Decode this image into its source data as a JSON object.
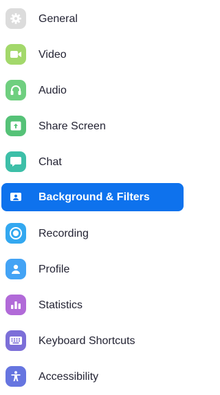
{
  "settings_nav": {
    "selected_index": 5,
    "items": [
      {
        "label": "General",
        "icon": "gear-icon",
        "color": "#dcdcdc"
      },
      {
        "label": "Video",
        "icon": "video-camera-icon",
        "color": "#a3d86b"
      },
      {
        "label": "Audio",
        "icon": "headphones-icon",
        "color": "#6fcf7f"
      },
      {
        "label": "Share Screen",
        "icon": "share-screen-icon",
        "color": "#55c277"
      },
      {
        "label": "Chat",
        "icon": "chat-bubble-icon",
        "color": "#3dbfa8"
      },
      {
        "label": "Background & Filters",
        "icon": "background-filters-icon",
        "color": "#ffffff"
      },
      {
        "label": "Recording",
        "icon": "record-icon",
        "color": "#33a8f0"
      },
      {
        "label": "Profile",
        "icon": "profile-icon",
        "color": "#43a3f5"
      },
      {
        "label": "Statistics",
        "icon": "statistics-icon",
        "color": "#b16ad8"
      },
      {
        "label": "Keyboard Shortcuts",
        "icon": "keyboard-icon",
        "color": "#7c6fd8"
      },
      {
        "label": "Accessibility",
        "icon": "accessibility-icon",
        "color": "#6675e0"
      }
    ]
  }
}
